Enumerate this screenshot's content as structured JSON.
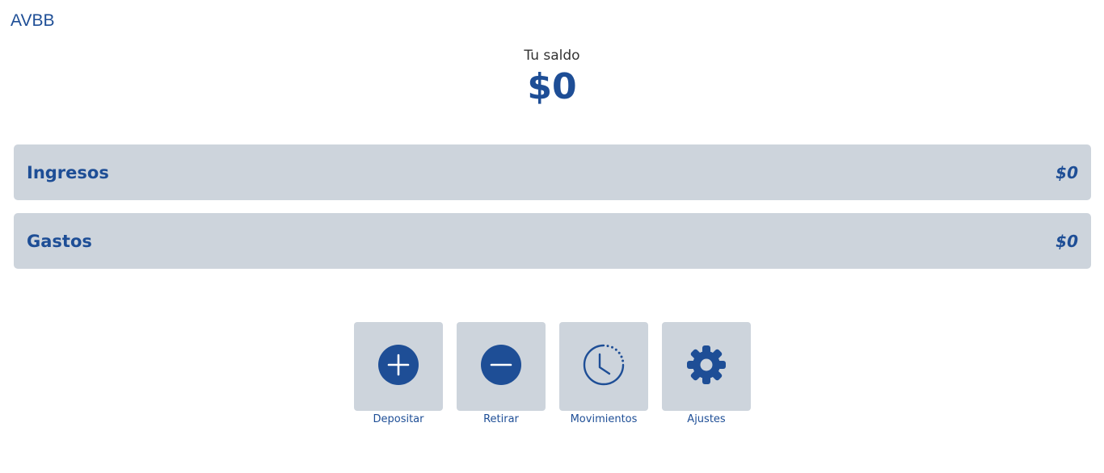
{
  "header": {
    "brand": "AVBB"
  },
  "balance": {
    "label": "Tu saldo",
    "amount": "$0"
  },
  "summary": {
    "income": {
      "label": "Ingresos",
      "value": "$0"
    },
    "expense": {
      "label": "Gastos",
      "value": "$0"
    }
  },
  "actions": [
    {
      "label": "Depositar",
      "icon": "plus-circle-icon"
    },
    {
      "label": "Retirar",
      "icon": "minus-circle-icon"
    },
    {
      "label": "Movimientos",
      "icon": "clock-history-icon"
    },
    {
      "label": "Ajustes",
      "icon": "gear-icon"
    }
  ],
  "colors": {
    "accent": "#1e4e96",
    "card": "#cdd4dc",
    "text": "#333333"
  }
}
